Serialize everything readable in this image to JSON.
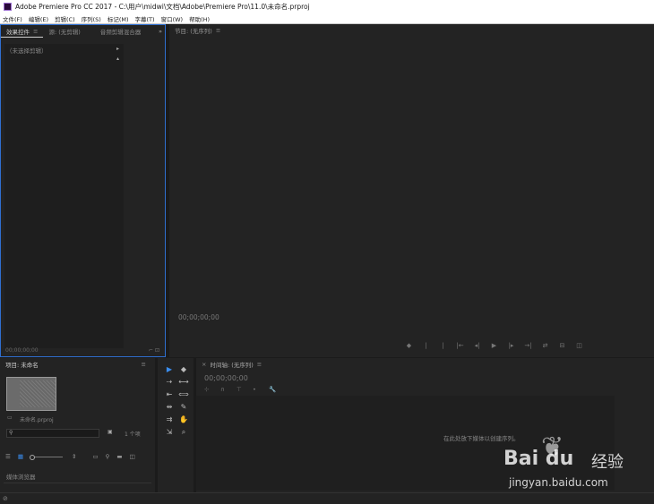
{
  "window": {
    "title": "Adobe Premiere Pro CC 2017 - C:\\用户\\midwi\\文档\\Adobe\\Premiere Pro\\11.0\\未命名.prproj"
  },
  "menu": [
    "文件(F)",
    "编辑(E)",
    "剪辑(C)",
    "序列(S)",
    "标记(M)",
    "字幕(T)",
    "窗口(W)",
    "帮助(H)"
  ],
  "effects_panel": {
    "tabs": [
      "效果控件",
      "源: (无剪辑)",
      "音频剪辑混合器"
    ],
    "no_clip": "（未选择剪辑）",
    "timecode": "00;00;00;00"
  },
  "program_panel": {
    "tab": "节目: (无序列)",
    "timecode": "00;00;00;00",
    "transport": [
      "◆",
      "|",
      "|",
      "|←",
      "◂|",
      "▶",
      "|▸",
      "→|",
      "⇄",
      "⊟",
      "◫"
    ]
  },
  "project_panel": {
    "tab": "项目: 未命名",
    "file": "未命名.prproj",
    "search_icon": "⚲",
    "items_count": "1 个项",
    "media_browser_tab": "媒体浏览器"
  },
  "tools": [
    "▶",
    "◆",
    "⇢",
    "⟷",
    "⇤",
    "⟺",
    "⇹",
    "✎",
    "⇉",
    "✋",
    "⇲",
    "⌕"
  ],
  "timeline_panel": {
    "tab": "时间轴: (无序列)",
    "timecode": "00;00;00;00",
    "tools": [
      "⊹",
      "∩",
      "⊤",
      "•",
      "🔧"
    ],
    "drop_hint": "在此处放下媒体以创建序列。"
  },
  "watermark": {
    "logo": "Bai du",
    "site_cn": "经验",
    "url": "jingyan.baidu.com"
  }
}
